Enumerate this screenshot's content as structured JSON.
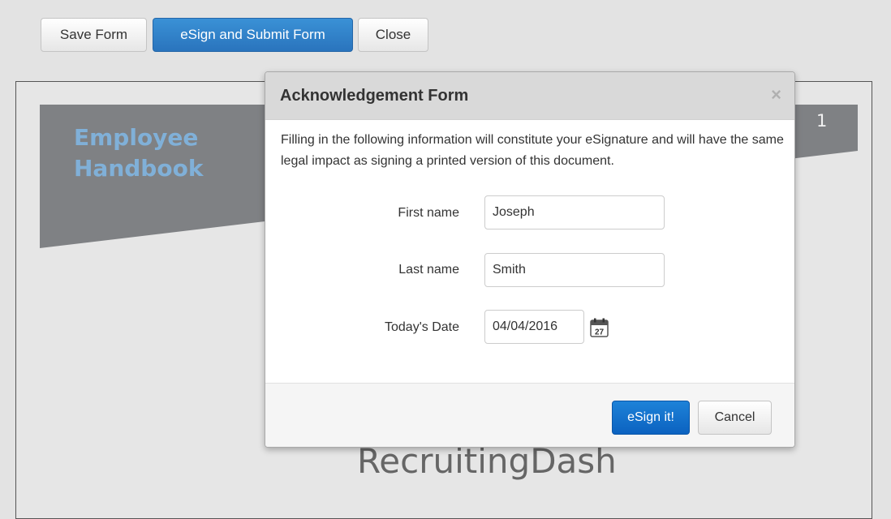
{
  "toolbar": {
    "save_label": "Save Form",
    "esign_submit_label": "eSign and Submit Form",
    "close_label": "Close"
  },
  "document": {
    "title_line1": "Employee",
    "title_line2": "Handbook",
    "page_number": "1",
    "brand": "RecruitingDash",
    "colors": {
      "banner": "#7f8184",
      "title": "#80b0d8"
    }
  },
  "modal": {
    "title": "Acknowledgement Form",
    "close_icon": "close-icon",
    "intro": "Filling in the following information will constitute your eSignature and will have the same legal impact as signing a printed version of this document.",
    "fields": {
      "first_name": {
        "label": "First name",
        "value": "Joseph"
      },
      "last_name": {
        "label": "Last name",
        "value": "Smith"
      },
      "date": {
        "label": "Today's Date",
        "value": "04/04/2016",
        "icon": "calendar-icon",
        "icon_day": "27"
      }
    },
    "esign_label": "eSign it!",
    "cancel_label": "Cancel"
  },
  "colors": {
    "primary": "#2a7fce",
    "esign": "#0f6cc9",
    "background": "#e3e3e3"
  }
}
